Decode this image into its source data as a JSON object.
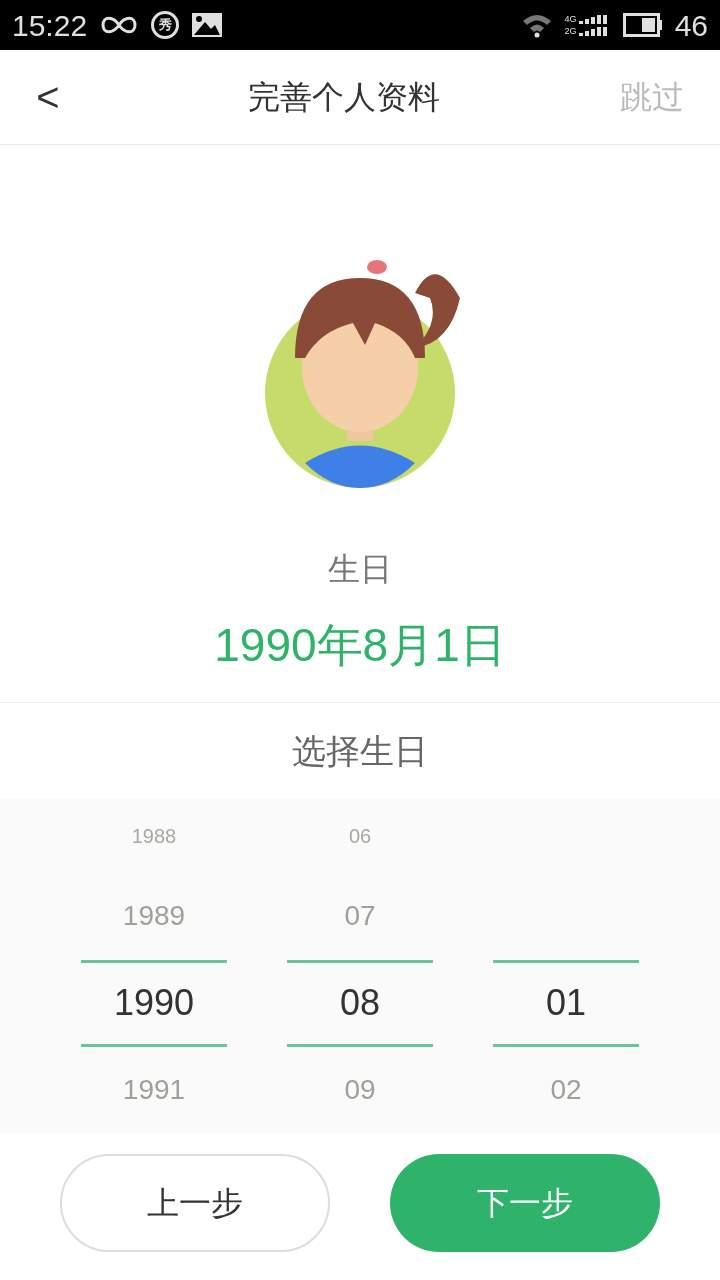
{
  "status_bar": {
    "time": "15:22",
    "app_badge": "秀",
    "network_labels": [
      "4G",
      "2G"
    ],
    "battery_text": "46"
  },
  "header": {
    "back": "<",
    "title": "完善个人资料",
    "skip": "跳过"
  },
  "birthday": {
    "label": "生日",
    "value": "1990年8月1日"
  },
  "picker": {
    "title": "选择生日",
    "columns": [
      {
        "items": [
          {
            "text": "1988",
            "selected": false
          },
          {
            "text": "1989",
            "selected": false
          },
          {
            "text": "1990",
            "selected": true
          },
          {
            "text": "1991",
            "selected": false
          }
        ]
      },
      {
        "items": [
          {
            "text": "06",
            "selected": false
          },
          {
            "text": "07",
            "selected": false
          },
          {
            "text": "08",
            "selected": true
          },
          {
            "text": "09",
            "selected": false
          }
        ]
      },
      {
        "items": [
          {
            "text": "01",
            "selected": true
          },
          {
            "text": "02",
            "selected": false
          }
        ]
      }
    ]
  },
  "buttons": [
    {
      "label": "上一步",
      "kind": "secondary"
    },
    {
      "label": "下一步",
      "kind": "primary"
    }
  ]
}
